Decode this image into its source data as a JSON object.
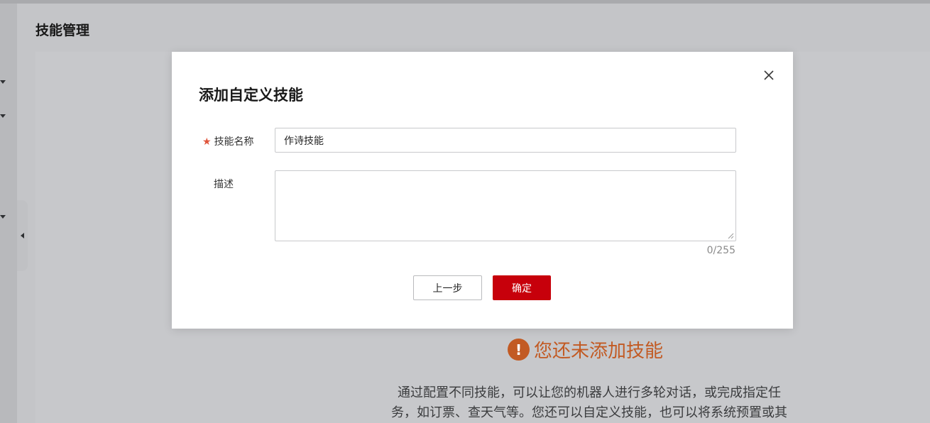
{
  "page": {
    "title": "技能管理",
    "empty_state": {
      "title": "您还未添加技能",
      "description_line1": "通过配置不同技能，可以让您的机器人进行多轮对话，或完成指定任",
      "description_line2": "务，如订票、查天气等。您还可以自定义技能，也可以将系统预置或其"
    }
  },
  "modal": {
    "title": "添加自定义技能",
    "fields": {
      "skill_name": {
        "label": "技能名称",
        "required_mark": "★",
        "value": "作诗技能"
      },
      "description": {
        "label": "描述",
        "value": "",
        "counter": "0/255"
      }
    },
    "buttons": {
      "prev": "上一步",
      "confirm": "确定"
    }
  },
  "colors": {
    "primary": "#c7000b",
    "warning": "#c25a23",
    "required": "#e0553b"
  },
  "icons": {
    "close": "close-icon",
    "warning": "warning-icon",
    "collapse": "chevron-left-icon"
  }
}
